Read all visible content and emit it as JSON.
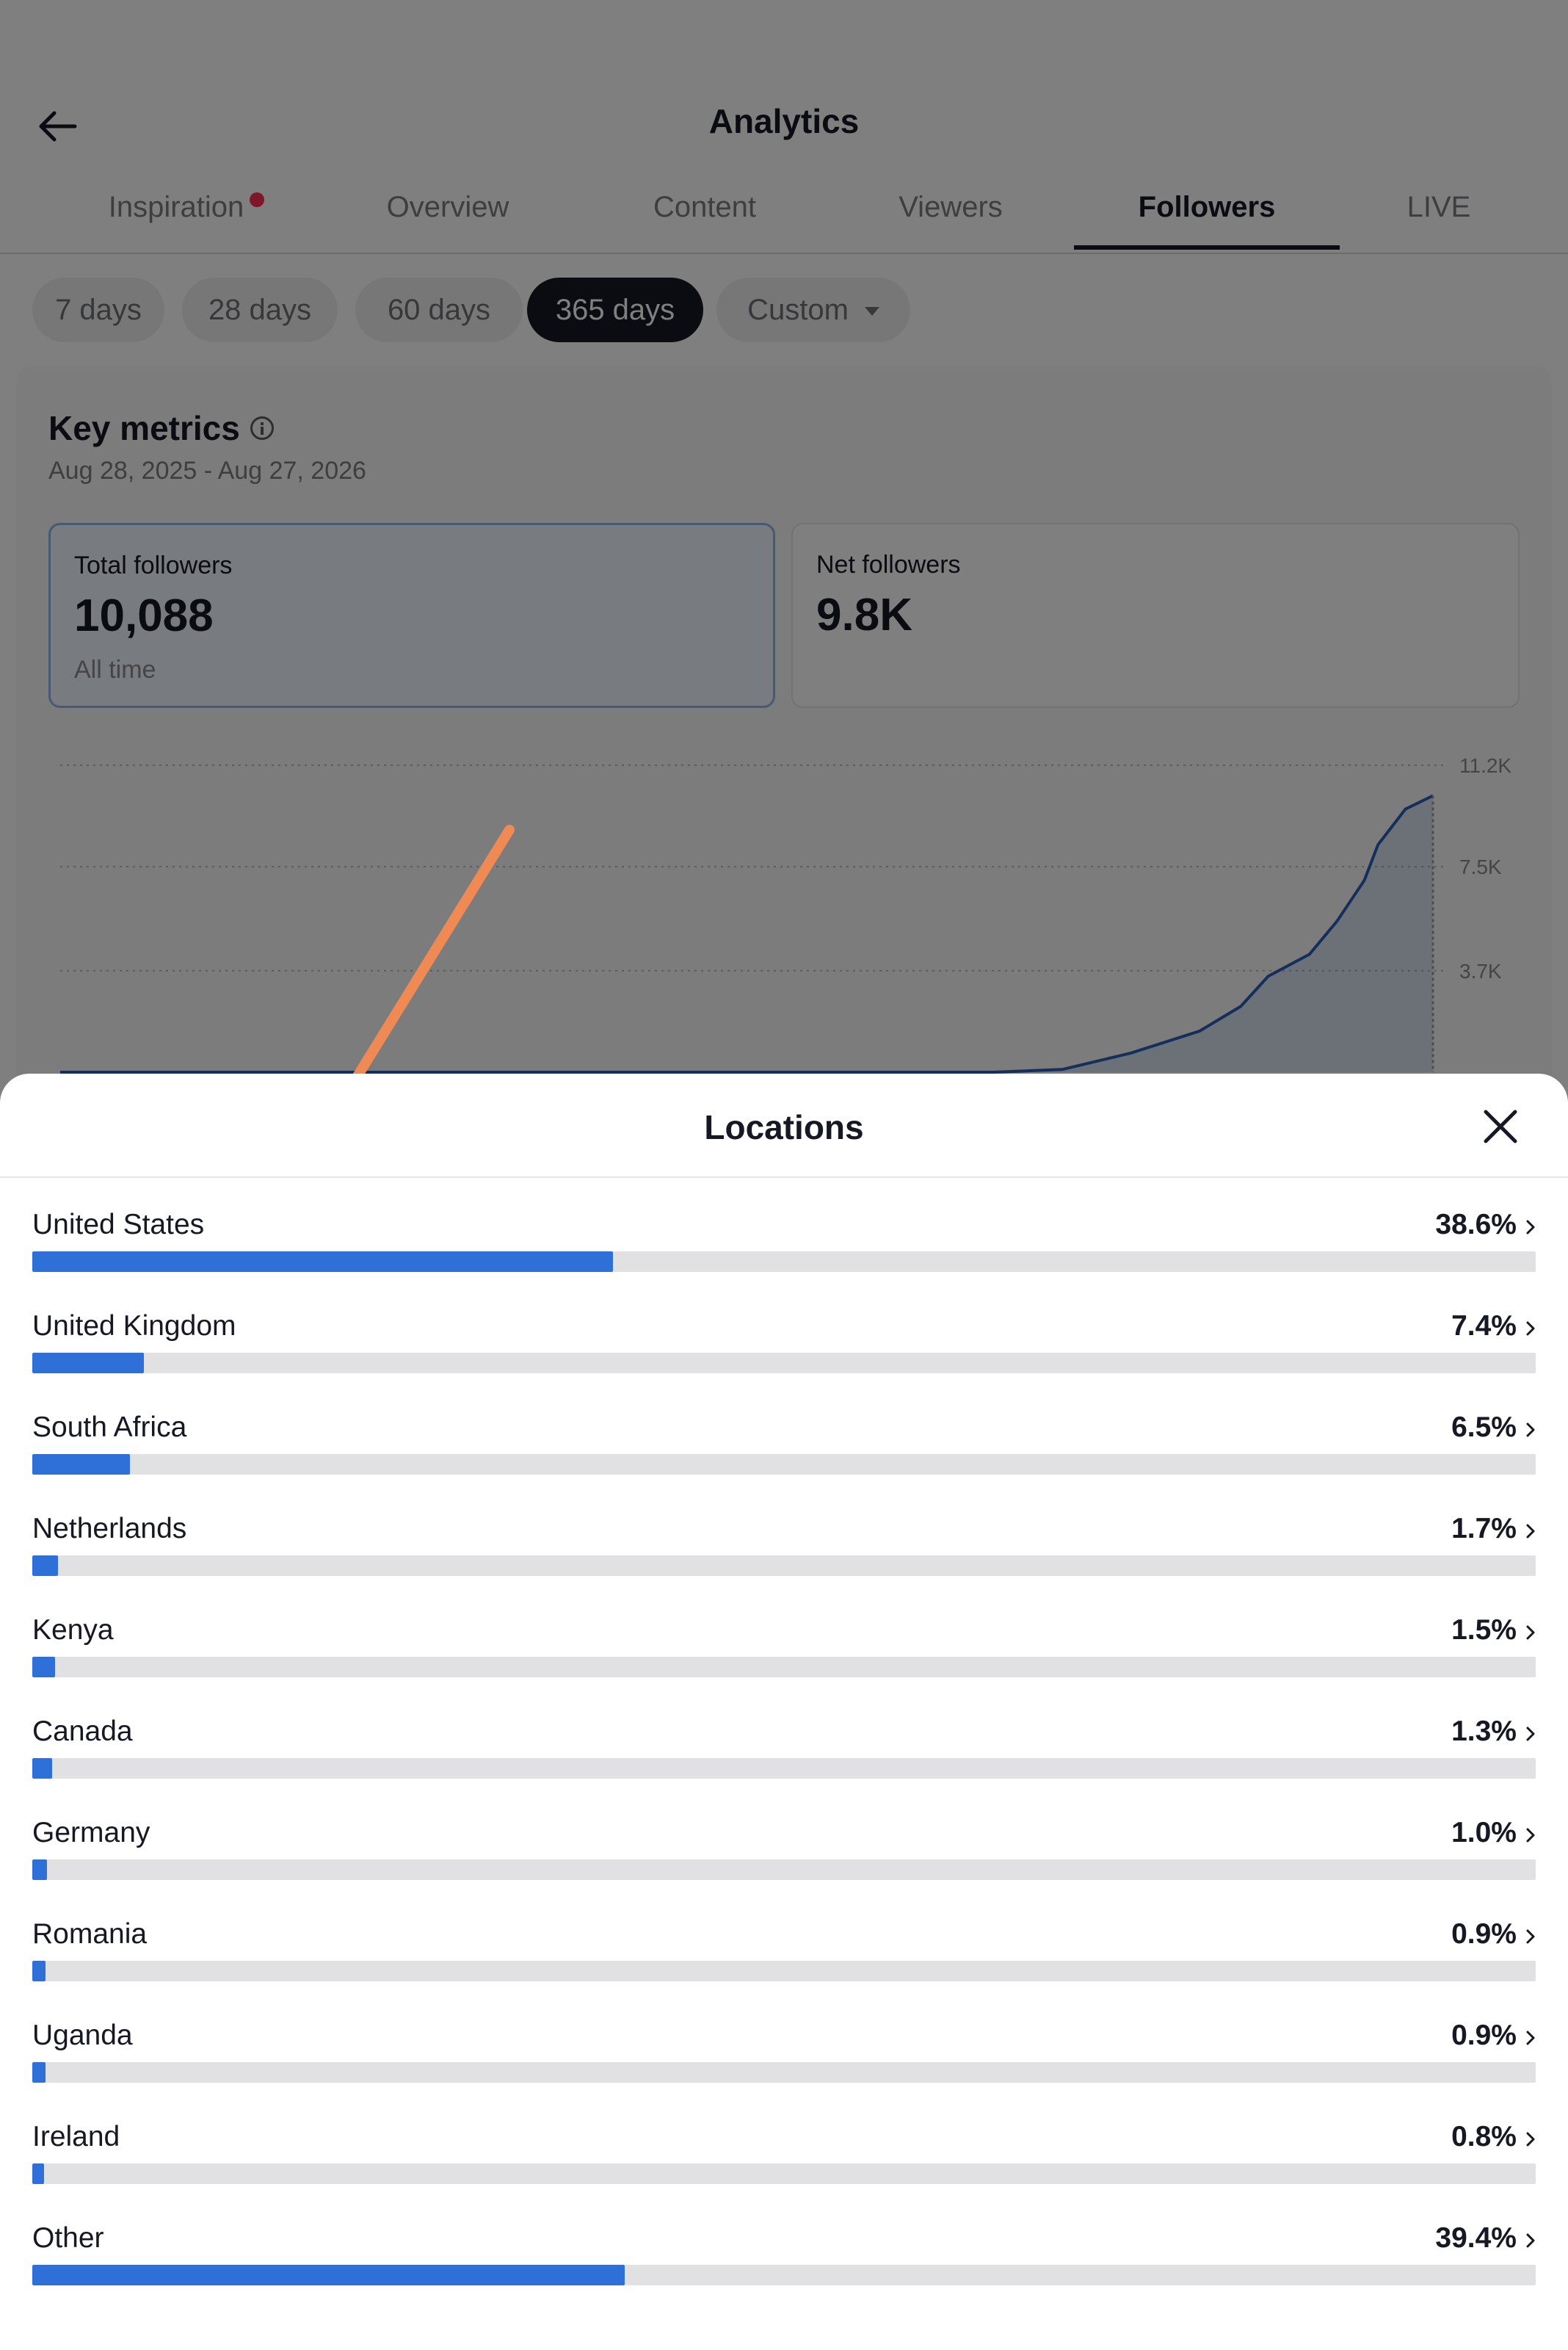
{
  "header": {
    "title": "Analytics",
    "back_icon": "arrow-left-icon"
  },
  "tabs": [
    {
      "label": "Inspiration",
      "active": false,
      "dot": true
    },
    {
      "label": "Overview",
      "active": false
    },
    {
      "label": "Content",
      "active": false
    },
    {
      "label": "Viewers",
      "active": false
    },
    {
      "label": "Followers",
      "active": true
    },
    {
      "label": "LIVE",
      "active": false
    }
  ],
  "date_ranges": [
    {
      "label": "7 days",
      "active": false
    },
    {
      "label": "28 days",
      "active": false
    },
    {
      "label": "60 days",
      "active": false
    },
    {
      "label": "365 days",
      "active": true
    },
    {
      "label": "Custom",
      "active": false,
      "dropdown": true
    }
  ],
  "key_metrics": {
    "title": "Key metrics",
    "date_range": "Aug 28, 2025 - Aug 27, 2026",
    "cards": [
      {
        "label": "Total followers",
        "value": "10,088",
        "sub": "All time",
        "selected": true
      },
      {
        "label": "Net followers",
        "value": "9.8K",
        "selected": false
      }
    ]
  },
  "chart_data": {
    "type": "area",
    "y_ticks": [
      "11.2K",
      "7.5K",
      "3.7K"
    ],
    "ylim": [
      0,
      11200
    ],
    "x_fraction": [
      0.0,
      0.3,
      0.4,
      0.5,
      0.55,
      0.62,
      0.68,
      0.73,
      0.78,
      0.83,
      0.86,
      0.88,
      0.91,
      0.93,
      0.95,
      0.96,
      0.98,
      1.0
    ],
    "values": [
      0,
      0,
      0,
      0,
      0,
      0,
      0,
      100,
      700,
      1500,
      2400,
      3500,
      4300,
      5500,
      7000,
      8300,
      9600,
      10088
    ],
    "accent_color": "#2b5fb8"
  },
  "sheet": {
    "title": "Locations",
    "close_icon": "close-icon",
    "locations": [
      {
        "name": "United States",
        "pct_label": "38.6%",
        "value": 38.6
      },
      {
        "name": "United Kingdom",
        "pct_label": "7.4%",
        "value": 7.4
      },
      {
        "name": "South Africa",
        "pct_label": "6.5%",
        "value": 6.5
      },
      {
        "name": "Netherlands",
        "pct_label": "1.7%",
        "value": 1.7
      },
      {
        "name": "Kenya",
        "pct_label": "1.5%",
        "value": 1.5
      },
      {
        "name": "Canada",
        "pct_label": "1.3%",
        "value": 1.3
      },
      {
        "name": "Germany",
        "pct_label": "1.0%",
        "value": 1.0
      },
      {
        "name": "Romania",
        "pct_label": "0.9%",
        "value": 0.9
      },
      {
        "name": "Uganda",
        "pct_label": "0.9%",
        "value": 0.9
      },
      {
        "name": "Ireland",
        "pct_label": "0.8%",
        "value": 0.8
      },
      {
        "name": "Other",
        "pct_label": "39.4%",
        "value": 39.4
      }
    ]
  },
  "colors": {
    "bar_fill": "#2f6fd8",
    "bar_track": "#e1e1e3",
    "annotation_arrow": "#f08a55",
    "tab_dot": "#fe2c55"
  }
}
